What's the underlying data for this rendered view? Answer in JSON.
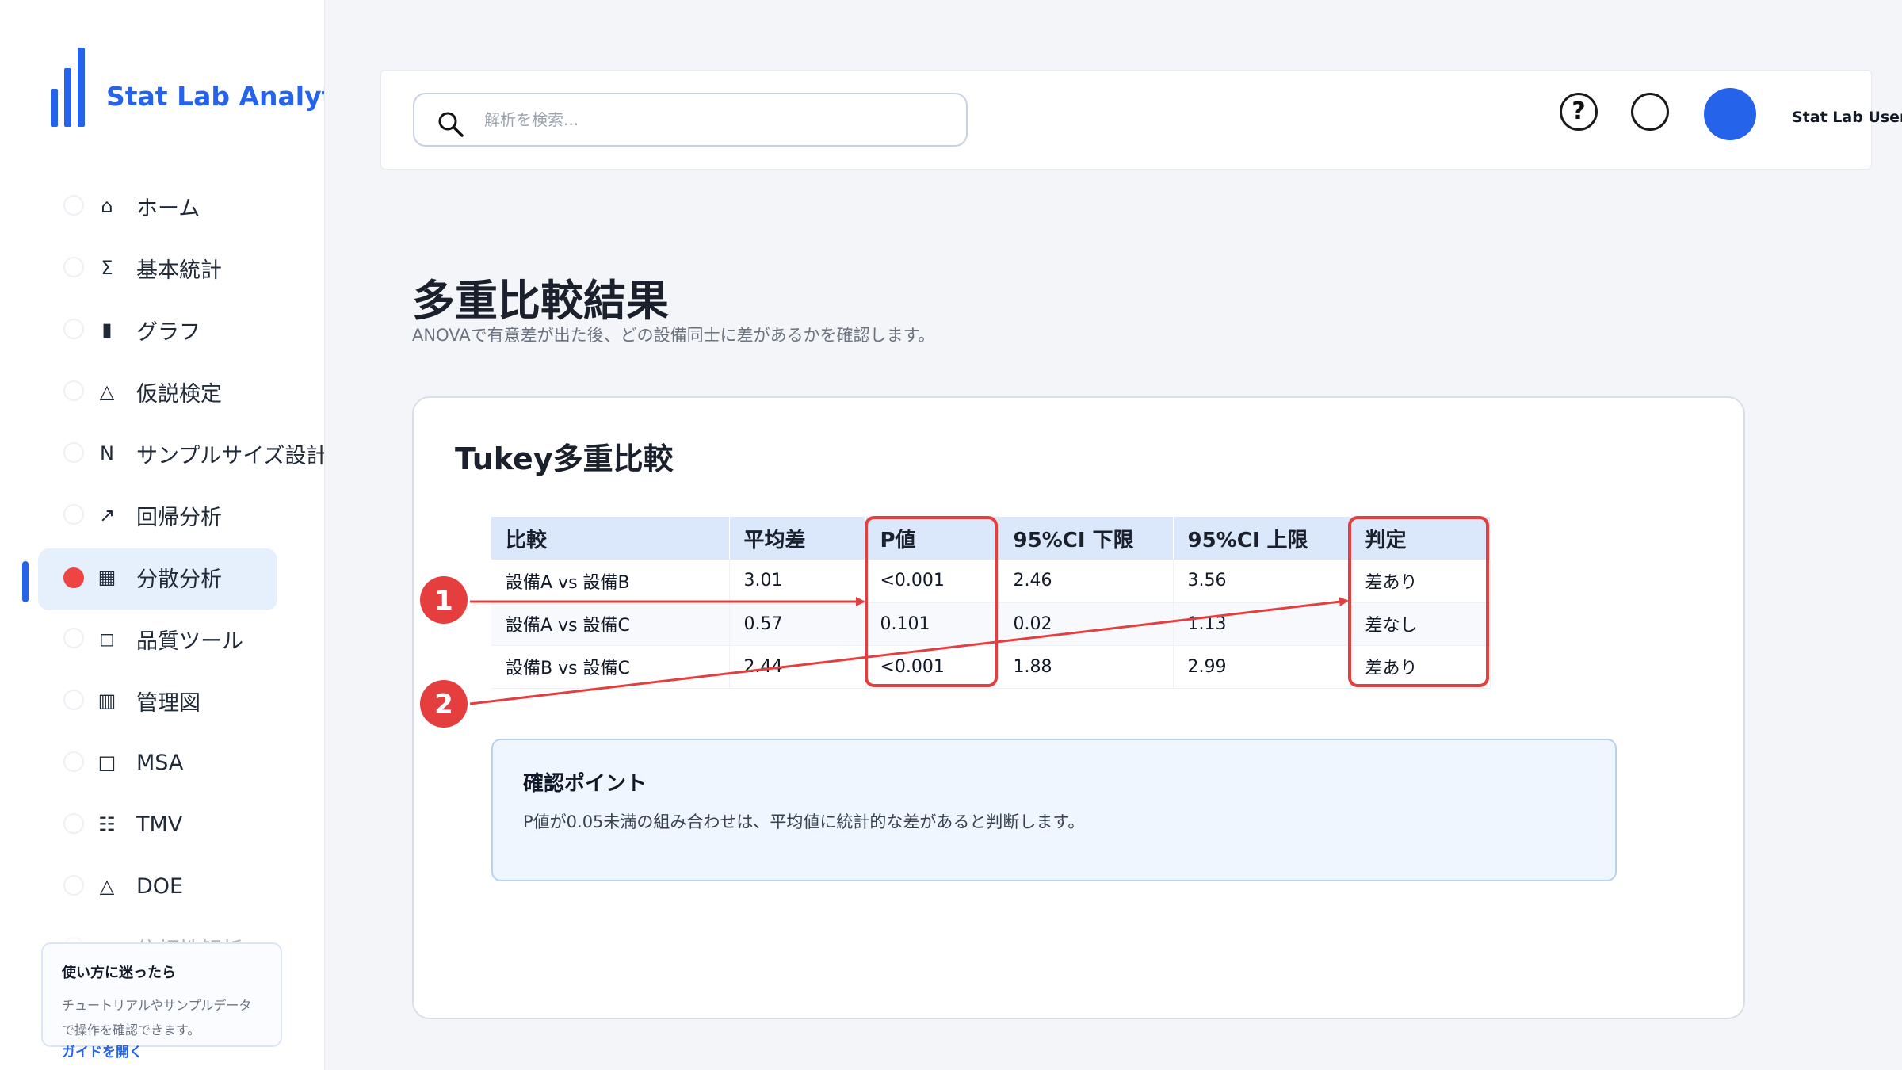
{
  "app": {
    "name": "Stat Lab Analytics"
  },
  "sidebar": {
    "items": [
      {
        "icon": "home-icon",
        "glyph": "⌂",
        "label": "ホーム"
      },
      {
        "icon": "sigma-icon",
        "glyph": "Σ",
        "label": "基本統計"
      },
      {
        "icon": "bar-chart-icon",
        "glyph": "▮",
        "label": "グラフ"
      },
      {
        "icon": "triangle-icon",
        "glyph": "△",
        "label": "仮説検定"
      },
      {
        "icon": "n-icon",
        "glyph": "N",
        "label": "サンプルサイズ設計"
      },
      {
        "icon": "trend-arrow-icon",
        "glyph": "↗",
        "label": "回帰分析"
      },
      {
        "icon": "grid-icon",
        "glyph": "▦",
        "label": "分散分析"
      },
      {
        "icon": "square-icon",
        "glyph": "◻",
        "label": "品質ツール"
      },
      {
        "icon": "control-chart-icon",
        "glyph": "▥",
        "label": "管理図"
      },
      {
        "icon": "square-outline-icon",
        "glyph": "□",
        "label": "MSA"
      },
      {
        "icon": "list-icon",
        "glyph": "☷",
        "label": "TMV"
      },
      {
        "icon": "triangle-outline-icon",
        "glyph": "△",
        "label": "DOE"
      },
      {
        "icon": "partial-icon",
        "glyph": "",
        "label": "信頼性解析"
      }
    ],
    "active_label": "分散分析",
    "help": {
      "title": "使い方に迷ったら",
      "text": "チュートリアルやサンプルデータで操作を確認できます。",
      "link": "ガイドを開く"
    }
  },
  "header": {
    "search_placeholder": "解析を検索...",
    "help_glyph": "?",
    "user_name": "Stat Lab User"
  },
  "page": {
    "title": "多重比較結果",
    "subtitle": "ANOVAで有意差が出た後、どの設備同士に差があるかを確認します。"
  },
  "card": {
    "title": "Tukey多重比較",
    "table": {
      "columns": [
        "比較",
        "平均差",
        "P値",
        "95%CI 下限",
        "95%CI 上限",
        "判定"
      ],
      "rows": [
        [
          "設備A vs 設備B",
          "3.01",
          "<0.001",
          "2.46",
          "3.56",
          "差あり"
        ],
        [
          "設備A vs 設備C",
          "0.57",
          "0.101",
          "0.02",
          "1.13",
          "差なし"
        ],
        [
          "設備B vs 設備C",
          "2.44",
          "<0.001",
          "1.88",
          "2.99",
          "差あり"
        ]
      ]
    },
    "tip": {
      "title": "確認ポイント",
      "text": "P値が0.05未満の組み合わせは、平均値に統計的な差があると判断します。"
    }
  },
  "annotations": {
    "color": "#e53e3e",
    "markers": [
      "1",
      "2"
    ]
  },
  "colors": {
    "accent": "#2563eb",
    "active_dot": "#ef4444",
    "annotation": "#e53e3e"
  }
}
